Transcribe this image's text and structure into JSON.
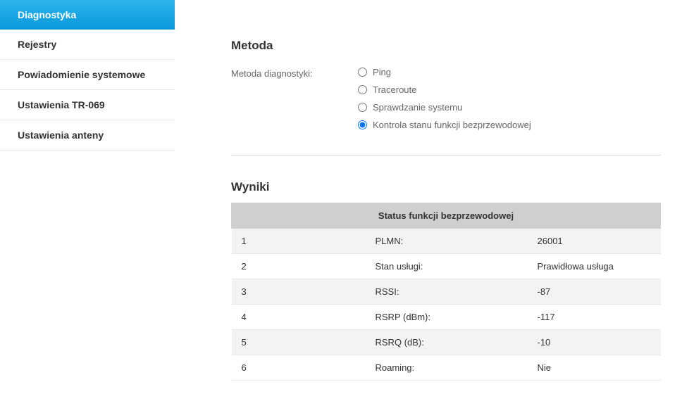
{
  "sidebar": {
    "items": [
      {
        "label": "Diagnostyka",
        "active": true
      },
      {
        "label": "Rejestry",
        "active": false
      },
      {
        "label": "Powiadomienie systemowe",
        "active": false
      },
      {
        "label": "Ustawienia TR-069",
        "active": false
      },
      {
        "label": "Ustawienia anteny",
        "active": false
      }
    ]
  },
  "method": {
    "section_title": "Metoda",
    "field_label": "Metoda diagnostyki:",
    "options": [
      {
        "label": "Ping",
        "checked": false
      },
      {
        "label": "Traceroute",
        "checked": false
      },
      {
        "label": "Sprawdzanie systemu",
        "checked": false
      },
      {
        "label": "Kontrola stanu funkcji bezprzewodowej",
        "checked": true
      }
    ]
  },
  "results": {
    "section_title": "Wyniki",
    "table_header": "Status funkcji bezprzewodowej",
    "rows": [
      {
        "idx": "1",
        "key": "PLMN:",
        "value": "26001"
      },
      {
        "idx": "2",
        "key": "Stan usługi:",
        "value": "Prawidłowa usługa"
      },
      {
        "idx": "3",
        "key": "RSSI:",
        "value": "-87"
      },
      {
        "idx": "4",
        "key": "RSRP (dBm):",
        "value": "-117"
      },
      {
        "idx": "5",
        "key": "RSRQ (dB):",
        "value": "-10"
      },
      {
        "idx": "6",
        "key": "Roaming:",
        "value": "Nie"
      }
    ]
  }
}
